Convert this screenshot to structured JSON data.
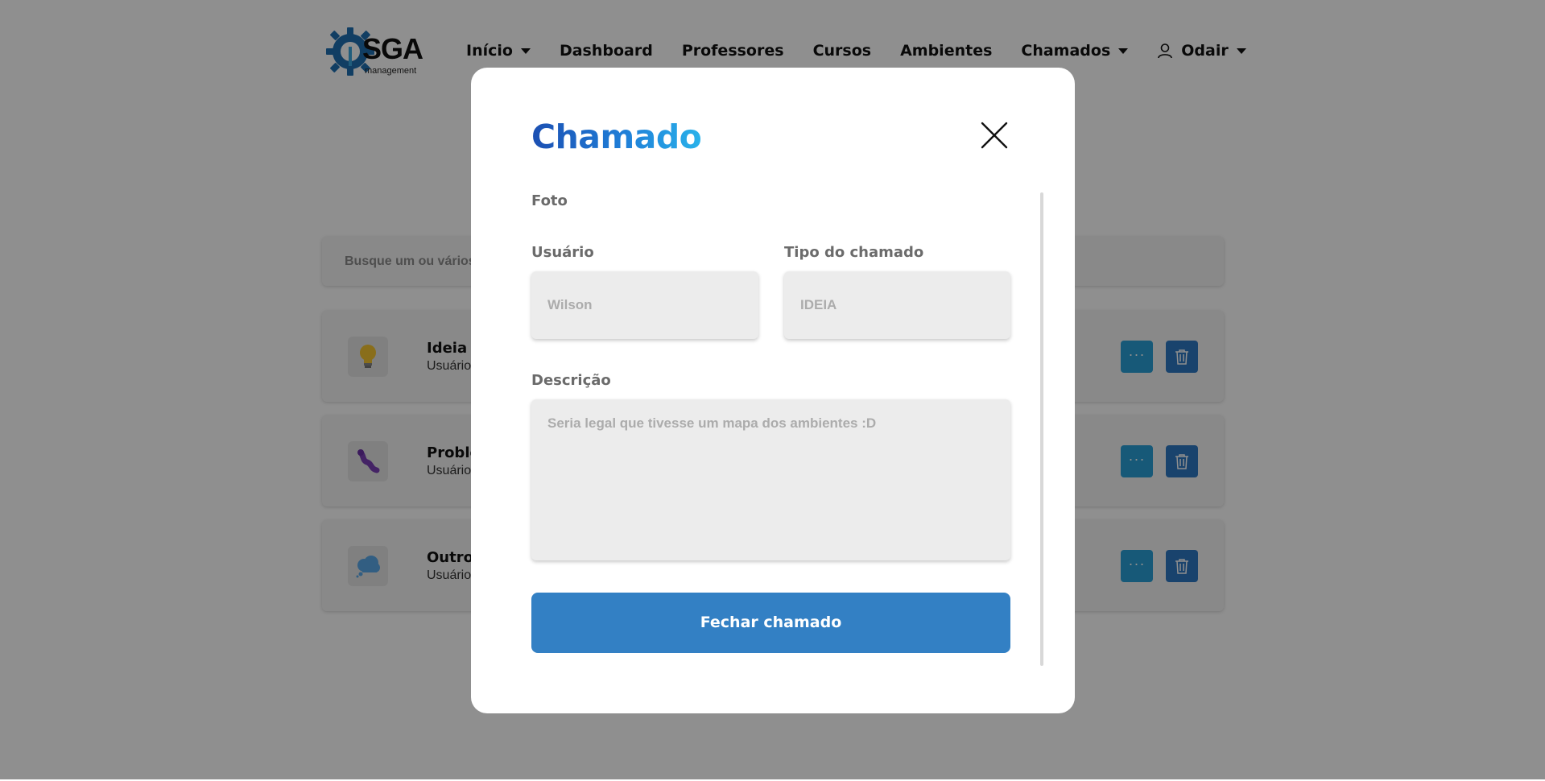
{
  "brand": {
    "name": "SGA",
    "subtitle": "management"
  },
  "nav": {
    "items": [
      "Início",
      "Dashboard",
      "Professores",
      "Cursos",
      "Ambientes",
      "Chamados"
    ],
    "user": "Odair"
  },
  "search": {
    "placeholder": "Busque um ou vários"
  },
  "tickets": [
    {
      "title": "Ideia",
      "subtitle": "Usuário"
    },
    {
      "title": "Proble",
      "subtitle": "Usuário"
    },
    {
      "title": "Outro",
      "subtitle": "Usuário"
    }
  ],
  "modal": {
    "title": "Chamado",
    "photo_label": "Foto",
    "user_label": "Usuário",
    "user_value": "Wilson",
    "type_label": "Tipo do chamado",
    "type_value": "IDEIA",
    "description_label": "Descrição",
    "description_value": "Seria legal que tivesse um mapa dos ambientes :D",
    "submit_label": "Fechar chamado"
  },
  "colors": {
    "title_gradient": [
      "#1c4fb2",
      "#29b2ea"
    ],
    "primary_button": "#3380c4",
    "more_button": "#2a9fd6",
    "delete_button": "#2e78c2"
  },
  "icons": [
    "gear-logo-icon",
    "user-icon",
    "lightbulb-icon",
    "worm-icon",
    "cloud-icon",
    "ellipsis-icon",
    "trash-icon",
    "close-icon"
  ]
}
